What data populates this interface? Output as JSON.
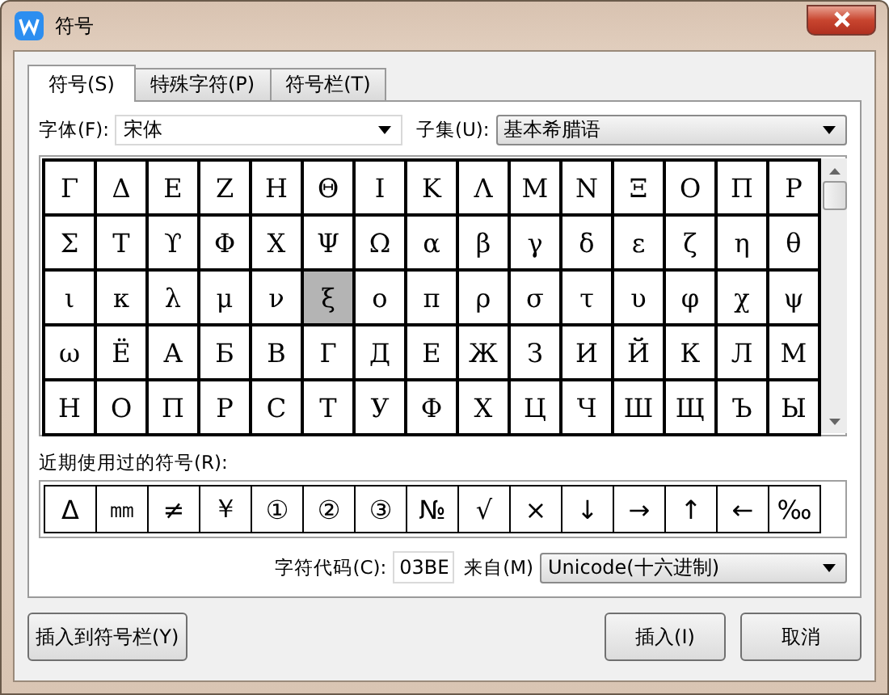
{
  "window": {
    "title": "符号"
  },
  "tabs": [
    {
      "label": "符号(S)",
      "selected": true
    },
    {
      "label": "特殊字符(P)",
      "selected": false
    },
    {
      "label": "符号栏(T)",
      "selected": false
    }
  ],
  "font": {
    "label": "字体(F):",
    "value": "宋体"
  },
  "subset": {
    "label": "子集(U):",
    "value": "基本希腊语"
  },
  "symbols": [
    [
      {
        "char": "Γ",
        "selected": false
      },
      {
        "char": "Δ",
        "selected": false
      },
      {
        "char": "Ε",
        "selected": false
      },
      {
        "char": "Ζ",
        "selected": false
      },
      {
        "char": "Η",
        "selected": false
      },
      {
        "char": "Θ",
        "selected": false
      },
      {
        "char": "Ι",
        "selected": false
      },
      {
        "char": "Κ",
        "selected": false
      },
      {
        "char": "Λ",
        "selected": false
      },
      {
        "char": "Μ",
        "selected": false
      },
      {
        "char": "Ν",
        "selected": false
      },
      {
        "char": "Ξ",
        "selected": false
      },
      {
        "char": "Ο",
        "selected": false
      },
      {
        "char": "Π",
        "selected": false
      },
      {
        "char": "Ρ",
        "selected": false
      }
    ],
    [
      {
        "char": "Σ",
        "selected": false
      },
      {
        "char": "Τ",
        "selected": false
      },
      {
        "char": "ϒ",
        "selected": false
      },
      {
        "char": "Φ",
        "selected": false
      },
      {
        "char": "Χ",
        "selected": false
      },
      {
        "char": "Ψ",
        "selected": false
      },
      {
        "char": "Ω",
        "selected": false
      },
      {
        "char": "α",
        "selected": false
      },
      {
        "char": "β",
        "selected": false
      },
      {
        "char": "γ",
        "selected": false
      },
      {
        "char": "δ",
        "selected": false
      },
      {
        "char": "ε",
        "selected": false
      },
      {
        "char": "ζ",
        "selected": false
      },
      {
        "char": "η",
        "selected": false
      },
      {
        "char": "θ",
        "selected": false
      }
    ],
    [
      {
        "char": "ι",
        "selected": false
      },
      {
        "char": "κ",
        "selected": false
      },
      {
        "char": "λ",
        "selected": false
      },
      {
        "char": "μ",
        "selected": false
      },
      {
        "char": "ν",
        "selected": false
      },
      {
        "char": "ξ",
        "selected": true
      },
      {
        "char": "ο",
        "selected": false
      },
      {
        "char": "π",
        "selected": false
      },
      {
        "char": "ρ",
        "selected": false
      },
      {
        "char": "σ",
        "selected": false
      },
      {
        "char": "τ",
        "selected": false
      },
      {
        "char": "υ",
        "selected": false
      },
      {
        "char": "φ",
        "selected": false
      },
      {
        "char": "χ",
        "selected": false
      },
      {
        "char": "ψ",
        "selected": false
      }
    ],
    [
      {
        "char": "ω",
        "selected": false
      },
      {
        "char": "Ё",
        "selected": false
      },
      {
        "char": "А",
        "selected": false
      },
      {
        "char": "Б",
        "selected": false
      },
      {
        "char": "В",
        "selected": false
      },
      {
        "char": "Г",
        "selected": false
      },
      {
        "char": "Д",
        "selected": false
      },
      {
        "char": "Е",
        "selected": false
      },
      {
        "char": "Ж",
        "selected": false
      },
      {
        "char": "З",
        "selected": false
      },
      {
        "char": "И",
        "selected": false
      },
      {
        "char": "Й",
        "selected": false
      },
      {
        "char": "К",
        "selected": false
      },
      {
        "char": "Л",
        "selected": false
      },
      {
        "char": "М",
        "selected": false
      }
    ],
    [
      {
        "char": "Н",
        "selected": false
      },
      {
        "char": "О",
        "selected": false
      },
      {
        "char": "П",
        "selected": false
      },
      {
        "char": "Р",
        "selected": false
      },
      {
        "char": "С",
        "selected": false
      },
      {
        "char": "Т",
        "selected": false
      },
      {
        "char": "У",
        "selected": false
      },
      {
        "char": "Ф",
        "selected": false
      },
      {
        "char": "Х",
        "selected": false
      },
      {
        "char": "Ц",
        "selected": false
      },
      {
        "char": "Ч",
        "selected": false
      },
      {
        "char": "Ш",
        "selected": false
      },
      {
        "char": "Щ",
        "selected": false
      },
      {
        "char": "Ъ",
        "selected": false
      },
      {
        "char": "Ы",
        "selected": false
      }
    ]
  ],
  "recent": {
    "label": "近期使用过的符号(R):",
    "items": [
      "Δ",
      "㎜",
      "≠",
      "￥",
      "①",
      "②",
      "③",
      "№",
      "√",
      "×",
      "↓",
      "→",
      "↑",
      "←",
      "‰"
    ]
  },
  "code": {
    "label": "字符代码(C):",
    "value": "03BE"
  },
  "from": {
    "label": "来自(M)",
    "value": "Unicode(十六进制)"
  },
  "buttons": [
    "插入到符号栏(Y)",
    "插入(I)",
    "取消"
  ]
}
